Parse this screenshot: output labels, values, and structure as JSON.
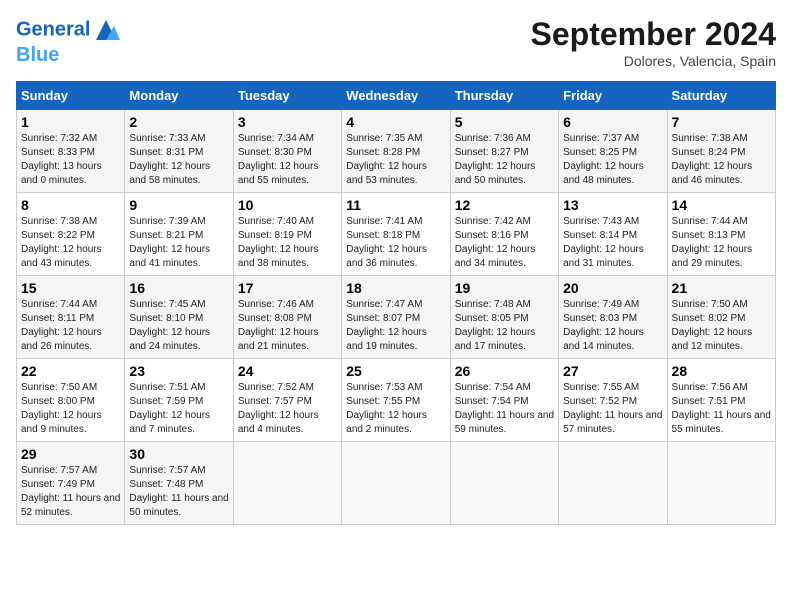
{
  "header": {
    "logo_line1": "General",
    "logo_line2": "Blue",
    "month_year": "September 2024",
    "location": "Dolores, Valencia, Spain"
  },
  "days_of_week": [
    "Sunday",
    "Monday",
    "Tuesday",
    "Wednesday",
    "Thursday",
    "Friday",
    "Saturday"
  ],
  "weeks": [
    [
      {
        "day": "1",
        "sunrise": "Sunrise: 7:32 AM",
        "sunset": "Sunset: 8:33 PM",
        "daylight": "Daylight: 13 hours and 0 minutes."
      },
      {
        "day": "2",
        "sunrise": "Sunrise: 7:33 AM",
        "sunset": "Sunset: 8:31 PM",
        "daylight": "Daylight: 12 hours and 58 minutes."
      },
      {
        "day": "3",
        "sunrise": "Sunrise: 7:34 AM",
        "sunset": "Sunset: 8:30 PM",
        "daylight": "Daylight: 12 hours and 55 minutes."
      },
      {
        "day": "4",
        "sunrise": "Sunrise: 7:35 AM",
        "sunset": "Sunset: 8:28 PM",
        "daylight": "Daylight: 12 hours and 53 minutes."
      },
      {
        "day": "5",
        "sunrise": "Sunrise: 7:36 AM",
        "sunset": "Sunset: 8:27 PM",
        "daylight": "Daylight: 12 hours and 50 minutes."
      },
      {
        "day": "6",
        "sunrise": "Sunrise: 7:37 AM",
        "sunset": "Sunset: 8:25 PM",
        "daylight": "Daylight: 12 hours and 48 minutes."
      },
      {
        "day": "7",
        "sunrise": "Sunrise: 7:38 AM",
        "sunset": "Sunset: 8:24 PM",
        "daylight": "Daylight: 12 hours and 46 minutes."
      }
    ],
    [
      {
        "day": "8",
        "sunrise": "Sunrise: 7:38 AM",
        "sunset": "Sunset: 8:22 PM",
        "daylight": "Daylight: 12 hours and 43 minutes."
      },
      {
        "day": "9",
        "sunrise": "Sunrise: 7:39 AM",
        "sunset": "Sunset: 8:21 PM",
        "daylight": "Daylight: 12 hours and 41 minutes."
      },
      {
        "day": "10",
        "sunrise": "Sunrise: 7:40 AM",
        "sunset": "Sunset: 8:19 PM",
        "daylight": "Daylight: 12 hours and 38 minutes."
      },
      {
        "day": "11",
        "sunrise": "Sunrise: 7:41 AM",
        "sunset": "Sunset: 8:18 PM",
        "daylight": "Daylight: 12 hours and 36 minutes."
      },
      {
        "day": "12",
        "sunrise": "Sunrise: 7:42 AM",
        "sunset": "Sunset: 8:16 PM",
        "daylight": "Daylight: 12 hours and 34 minutes."
      },
      {
        "day": "13",
        "sunrise": "Sunrise: 7:43 AM",
        "sunset": "Sunset: 8:14 PM",
        "daylight": "Daylight: 12 hours and 31 minutes."
      },
      {
        "day": "14",
        "sunrise": "Sunrise: 7:44 AM",
        "sunset": "Sunset: 8:13 PM",
        "daylight": "Daylight: 12 hours and 29 minutes."
      }
    ],
    [
      {
        "day": "15",
        "sunrise": "Sunrise: 7:44 AM",
        "sunset": "Sunset: 8:11 PM",
        "daylight": "Daylight: 12 hours and 26 minutes."
      },
      {
        "day": "16",
        "sunrise": "Sunrise: 7:45 AM",
        "sunset": "Sunset: 8:10 PM",
        "daylight": "Daylight: 12 hours and 24 minutes."
      },
      {
        "day": "17",
        "sunrise": "Sunrise: 7:46 AM",
        "sunset": "Sunset: 8:08 PM",
        "daylight": "Daylight: 12 hours and 21 minutes."
      },
      {
        "day": "18",
        "sunrise": "Sunrise: 7:47 AM",
        "sunset": "Sunset: 8:07 PM",
        "daylight": "Daylight: 12 hours and 19 minutes."
      },
      {
        "day": "19",
        "sunrise": "Sunrise: 7:48 AM",
        "sunset": "Sunset: 8:05 PM",
        "daylight": "Daylight: 12 hours and 17 minutes."
      },
      {
        "day": "20",
        "sunrise": "Sunrise: 7:49 AM",
        "sunset": "Sunset: 8:03 PM",
        "daylight": "Daylight: 12 hours and 14 minutes."
      },
      {
        "day": "21",
        "sunrise": "Sunrise: 7:50 AM",
        "sunset": "Sunset: 8:02 PM",
        "daylight": "Daylight: 12 hours and 12 minutes."
      }
    ],
    [
      {
        "day": "22",
        "sunrise": "Sunrise: 7:50 AM",
        "sunset": "Sunset: 8:00 PM",
        "daylight": "Daylight: 12 hours and 9 minutes."
      },
      {
        "day": "23",
        "sunrise": "Sunrise: 7:51 AM",
        "sunset": "Sunset: 7:59 PM",
        "daylight": "Daylight: 12 hours and 7 minutes."
      },
      {
        "day": "24",
        "sunrise": "Sunrise: 7:52 AM",
        "sunset": "Sunset: 7:57 PM",
        "daylight": "Daylight: 12 hours and 4 minutes."
      },
      {
        "day": "25",
        "sunrise": "Sunrise: 7:53 AM",
        "sunset": "Sunset: 7:55 PM",
        "daylight": "Daylight: 12 hours and 2 minutes."
      },
      {
        "day": "26",
        "sunrise": "Sunrise: 7:54 AM",
        "sunset": "Sunset: 7:54 PM",
        "daylight": "Daylight: 11 hours and 59 minutes."
      },
      {
        "day": "27",
        "sunrise": "Sunrise: 7:55 AM",
        "sunset": "Sunset: 7:52 PM",
        "daylight": "Daylight: 11 hours and 57 minutes."
      },
      {
        "day": "28",
        "sunrise": "Sunrise: 7:56 AM",
        "sunset": "Sunset: 7:51 PM",
        "daylight": "Daylight: 11 hours and 55 minutes."
      }
    ],
    [
      {
        "day": "29",
        "sunrise": "Sunrise: 7:57 AM",
        "sunset": "Sunset: 7:49 PM",
        "daylight": "Daylight: 11 hours and 52 minutes."
      },
      {
        "day": "30",
        "sunrise": "Sunrise: 7:57 AM",
        "sunset": "Sunset: 7:48 PM",
        "daylight": "Daylight: 11 hours and 50 minutes."
      },
      {
        "day": "",
        "sunrise": "",
        "sunset": "",
        "daylight": ""
      },
      {
        "day": "",
        "sunrise": "",
        "sunset": "",
        "daylight": ""
      },
      {
        "day": "",
        "sunrise": "",
        "sunset": "",
        "daylight": ""
      },
      {
        "day": "",
        "sunrise": "",
        "sunset": "",
        "daylight": ""
      },
      {
        "day": "",
        "sunrise": "",
        "sunset": "",
        "daylight": ""
      }
    ]
  ]
}
